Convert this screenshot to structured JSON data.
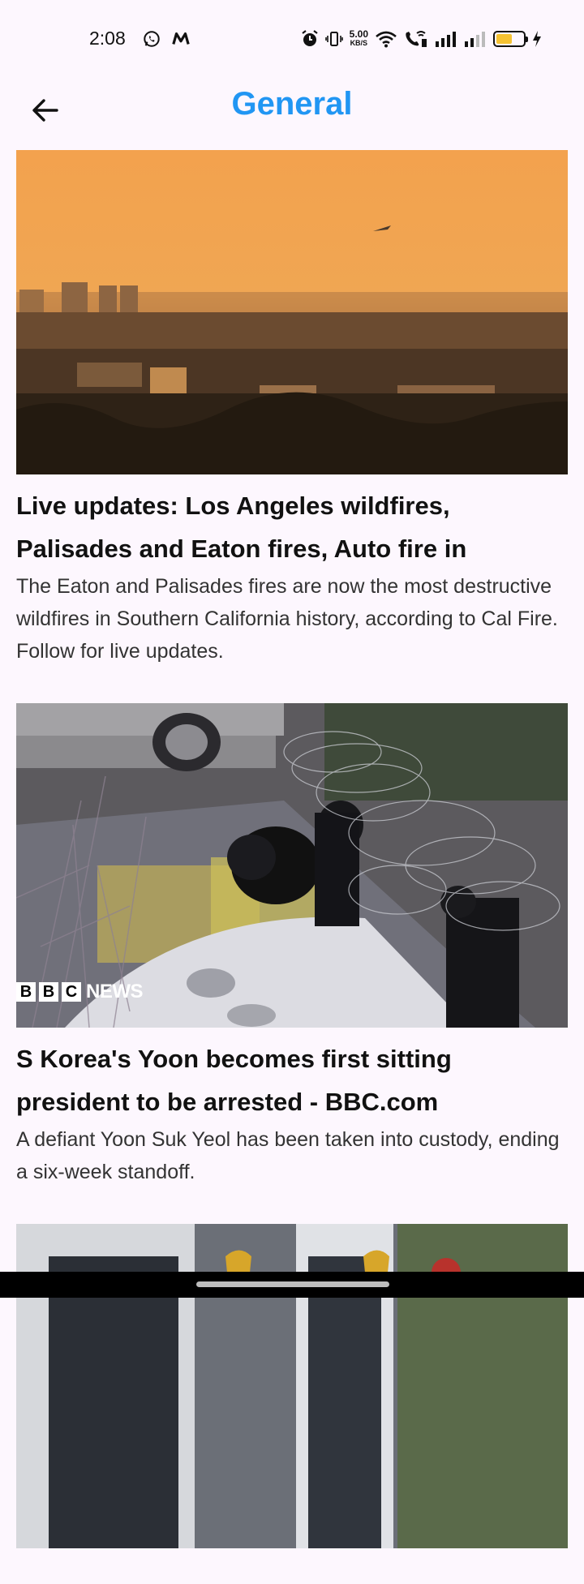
{
  "status_bar": {
    "time": "2:08",
    "net_speed_value": "5.00",
    "net_speed_unit": "KB/S",
    "battery_level": 0.6
  },
  "app_bar": {
    "title": "General",
    "back_icon": "arrow-left-icon"
  },
  "articles": [
    {
      "title": "Live updates: Los Angeles wildfires, Palisades and Eaton fires, Auto fire in",
      "description": "The Eaton and Palisades fires are now the most destructive wildfires in Southern California history, according to Cal Fire. Follow for live updates."
    },
    {
      "title": "S Korea's Yoon becomes first sitting president to be arrested - BBC.com",
      "description": "A defiant Yoon Suk Yeol has been taken into custody, ending a six-week standoff.",
      "image_logo": {
        "b1": "B",
        "b2": "B",
        "b3": "C",
        "news": "NEWS"
      }
    }
  ],
  "colors": {
    "accent": "#2196f3",
    "background": "#fdf7fe"
  }
}
